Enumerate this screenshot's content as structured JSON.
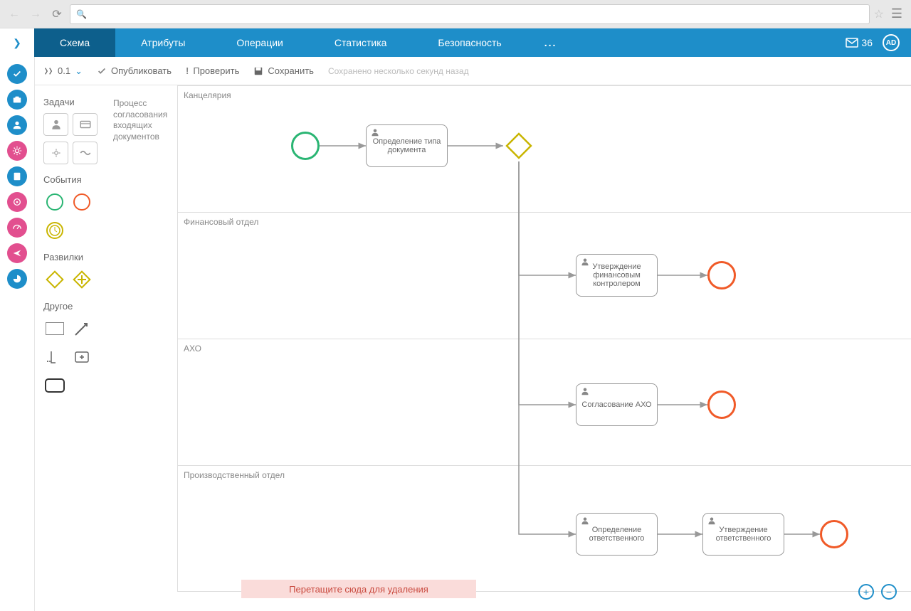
{
  "tabs": {
    "schema": "Схема",
    "attributes": "Атрибуты",
    "operations": "Операции",
    "statistics": "Статистика",
    "security": "Безопасность",
    "more": "..."
  },
  "mailCount": "36",
  "avatar": "AD",
  "toolbar": {
    "version": "0.1",
    "publish": "Опубликовать",
    "check": "Проверить",
    "save": "Сохранить",
    "status": "Сохранено несколько секунд назад"
  },
  "palette": {
    "tasks": "Задачи",
    "events": "События",
    "gateways": "Развилки",
    "other": "Другое"
  },
  "railColors": [
    "#1e8ec9",
    "#1e8ec9",
    "#1e8ec9",
    "#e24f8f",
    "#1e8ec9",
    "#e24f8f",
    "#e24f8f",
    "#e24f8f",
    "#1e8ec9"
  ],
  "pool": {
    "title": "Процесс согласования входящих документов",
    "lanes": [
      {
        "name": "Канцелярия"
      },
      {
        "name": "Финансовый отдел"
      },
      {
        "name": "АХО"
      },
      {
        "name": "Производственный отдел"
      }
    ]
  },
  "nodes": {
    "task1": "Определение типа документа",
    "task2": "Утверждение финансовым контролером",
    "task3": "Согласование АХО",
    "task4": "Определение ответственного",
    "task5": "Утверждение ответственного"
  },
  "dropZone": "Перетащите сюда для удаления"
}
